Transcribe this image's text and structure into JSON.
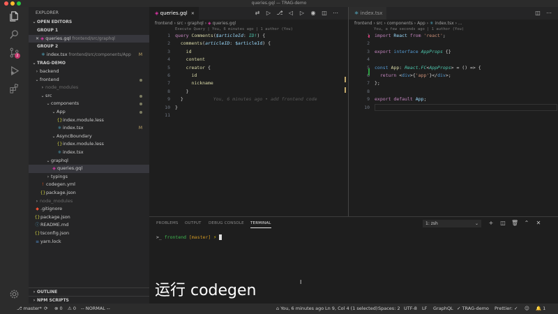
{
  "window": {
    "title": "queries.gql — TRAG-demo"
  },
  "colors": {
    "accent_badge": "#c5396e",
    "modified": "#c2a86a",
    "activitybar": "#2c2c2c",
    "sidebar": "#252526",
    "editor": "#1e1e1e"
  },
  "activity_icons": [
    "files-icon",
    "search-icon",
    "source-control-icon",
    "debug-icon",
    "extensions-icon",
    "settings-icon"
  ],
  "source_control_badge": "2",
  "explorer": {
    "header": "EXPLORER",
    "open_editors": "OPEN EDITORS",
    "group1": "GROUP 1",
    "group1_file": {
      "name": "queries.gql",
      "path": "frontend/src/graphql"
    },
    "group2": "GROUP 2",
    "group2_file": {
      "name": "index.tsx",
      "path": "frontend/src/components/App",
      "mark": "M"
    },
    "root": "TRAG-DEMO",
    "tree": [
      {
        "label": "backend",
        "depth": 1,
        "chev": "›"
      },
      {
        "label": "frontend",
        "depth": 1,
        "chev": "⌄",
        "dot": true
      },
      {
        "label": "node_modules",
        "depth": 2,
        "chev": "›",
        "dim": true
      },
      {
        "label": "src",
        "depth": 2,
        "chev": "⌄",
        "dot": true
      },
      {
        "label": "components",
        "depth": 3,
        "chev": "⌄",
        "dot": true
      },
      {
        "label": "App",
        "depth": 4,
        "chev": "⌄",
        "dot": true
      },
      {
        "label": "index.module.less",
        "depth": 5,
        "icon": "{}"
      },
      {
        "label": "index.tsx",
        "depth": 5,
        "icon": "⚛",
        "mark": "M"
      },
      {
        "label": "AsyncBoundary",
        "depth": 4,
        "chev": "⌄"
      },
      {
        "label": "index.module.less",
        "depth": 5,
        "icon": "{}"
      },
      {
        "label": "index.tsx",
        "depth": 5,
        "icon": "⚛"
      },
      {
        "label": "graphql",
        "depth": 3,
        "chev": "⌄"
      },
      {
        "label": "queries.gql",
        "depth": 4,
        "icon": "◈",
        "selected": true
      },
      {
        "label": "typings",
        "depth": 3,
        "chev": "›"
      },
      {
        "label": "codegen.yml",
        "depth": 2,
        "icon": "!"
      },
      {
        "label": "package.json",
        "depth": 2,
        "icon": "{}"
      },
      {
        "label": "node_modules",
        "depth": 1,
        "chev": "›",
        "dim": true
      },
      {
        "label": ".gitignore",
        "depth": 1,
        "icon": "◆"
      },
      {
        "label": "package.json",
        "depth": 1,
        "icon": "{}"
      },
      {
        "label": "README.md",
        "depth": 1,
        "icon": "ⓘ"
      },
      {
        "label": "tsconfig.json",
        "depth": 1,
        "icon": "{}"
      },
      {
        "label": "yarn.lock",
        "depth": 1,
        "icon": "≡"
      }
    ],
    "outline": "OUTLINE",
    "npm_scripts": "NPM SCRIPTS"
  },
  "left_editor": {
    "tab": "queries.gql",
    "breadcrumb": [
      "frontend",
      "src",
      "graphql",
      "queries.gql"
    ],
    "codelens": "Execute Query | You, 6 minutes ago | 1 author (You)",
    "ghost_blame": "You, 6 minutes ago • add frontend code",
    "line_numbers": [
      "1",
      "2",
      "3",
      "4",
      "5",
      "6",
      "7",
      "8",
      "9",
      "10",
      "11"
    ]
  },
  "right_editor": {
    "tab": "index.tsx",
    "breadcrumb": [
      "frontend",
      "src",
      "components",
      "App",
      "index.tsx",
      "..."
    ],
    "codelens": "You, a few seconds ago | 1 author (You)",
    "line_numbers": [
      "1",
      "2",
      "3",
      "4",
      "5",
      "6",
      "7",
      "8",
      "9",
      "10"
    ]
  },
  "panel": {
    "tabs": [
      "PROBLEMS",
      "OUTPUT",
      "DEBUG CONSOLE",
      "TERMINAL"
    ],
    "active_tab": "TERMINAL",
    "terminal_select": "1: zsh",
    "prompt_dir": "frontend",
    "prompt_branch": "[master]",
    "prompt_symbol": "⚡"
  },
  "caption": "运行 codegen",
  "statusbar": {
    "branch": "master*",
    "sync": "⟳",
    "errors": "⊗ 0",
    "warnings": "⚠ 0",
    "mode": "-- NORMAL --",
    "blame": "You, 6 minutes ago",
    "position": "Ln 9, Col 4 (1 selected)",
    "spaces": "Spaces: 2",
    "encoding": "UTF-8",
    "eol": "LF",
    "language": "GraphQL",
    "project": "TRAG-demo",
    "formatter": "Prettier: ✓",
    "bell_count": "1"
  }
}
